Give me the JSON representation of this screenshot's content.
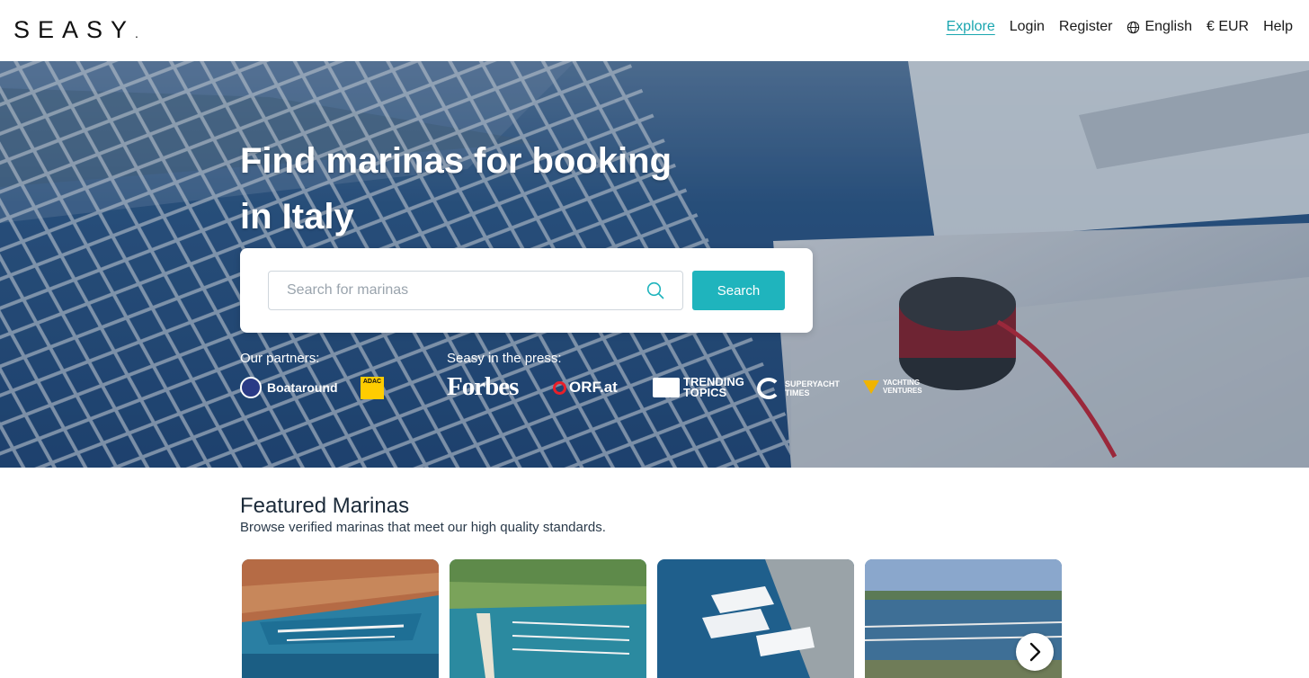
{
  "header": {
    "logo": "SEASY",
    "logo_mark": ".",
    "nav": {
      "explore": "Explore",
      "login": "Login",
      "register": "Register",
      "language": "English",
      "currency": "€ EUR",
      "help": "Help"
    }
  },
  "hero": {
    "title_line1": "Find marinas for booking",
    "title_line2": "in Italy",
    "search": {
      "placeholder": "Search for marinas",
      "button": "Search"
    },
    "partners_label": "Our partners:",
    "partners": {
      "boataround": "Boataround",
      "adac": "ADAC"
    },
    "press_label": "Seasy in the press:",
    "press": {
      "forbes": "Forbes",
      "orf": "ORF.at",
      "trending_1": "TRENDING",
      "trending_2": "TOPICS",
      "superyacht_1": "SUPERYACHT",
      "superyacht_2": "TIMES",
      "yachting_1": "YACHTING",
      "yachting_2": "VENTURES"
    }
  },
  "featured": {
    "title": "Featured Marinas",
    "subtitle": "Browse verified marinas that meet our high quality standards."
  },
  "colors": {
    "accent": "#1fb4bd",
    "nav_active": "#1aa6b0"
  }
}
